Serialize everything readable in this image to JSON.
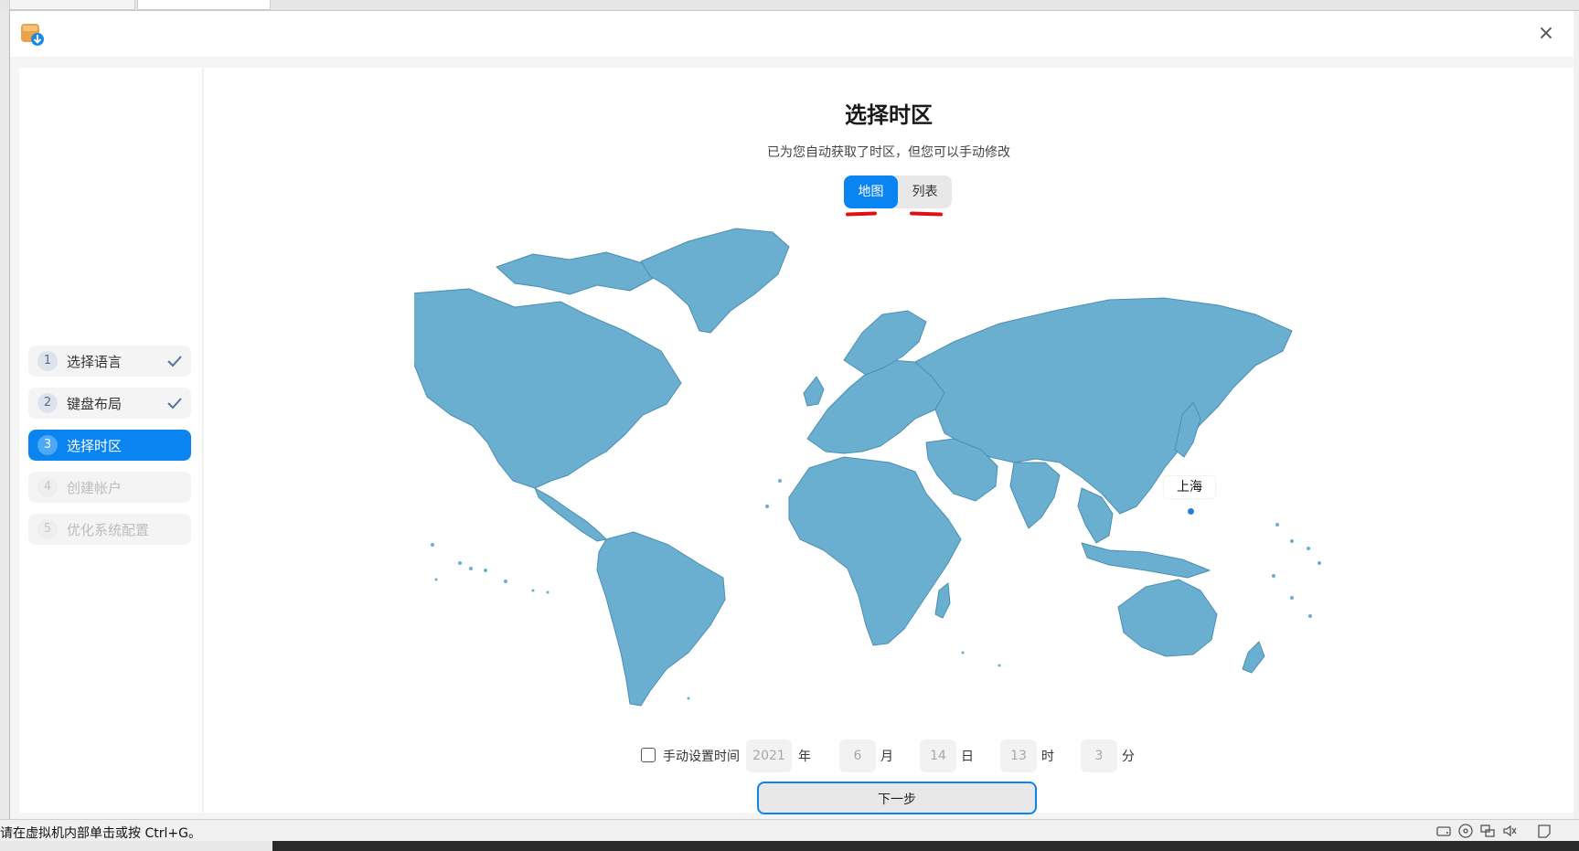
{
  "window": {
    "close_icon": "close-icon",
    "app_icon": "installer-app-icon"
  },
  "sidebar": {
    "steps": [
      {
        "num": "1",
        "label": "选择语言",
        "state": "done"
      },
      {
        "num": "2",
        "label": "键盘布局",
        "state": "done"
      },
      {
        "num": "3",
        "label": "选择时区",
        "state": "active"
      },
      {
        "num": "4",
        "label": "创建帐户",
        "state": "disabled"
      },
      {
        "num": "5",
        "label": "优化系统配置",
        "state": "disabled"
      }
    ]
  },
  "main": {
    "title": "选择时区",
    "subtitle": "已为您自动获取了时区，但您可以手动修改",
    "tabs": [
      {
        "label": "地图",
        "selected": true
      },
      {
        "label": "列表",
        "selected": false
      }
    ],
    "map": {
      "selected_city": "上海",
      "land_color": "#6aaed0",
      "border_color": "#4b8fb5"
    },
    "manual_time": {
      "label": "手动设置时间",
      "checked": false,
      "year": "2021",
      "year_unit": "年",
      "month": "6",
      "month_unit": "月",
      "day": "14",
      "day_unit": "日",
      "hour": "13",
      "hour_unit": "时",
      "minute": "3",
      "minute_unit": "分"
    },
    "next_label": "下一步"
  },
  "statusbar": {
    "text": "请在虚拟机内部单击或按 Ctrl+G。",
    "tray_icons": [
      "hdd-icon",
      "cd-icon",
      "network-icon",
      "sound-icon",
      "message-icon"
    ]
  },
  "colors": {
    "accent": "#0a84f0",
    "annotation": "#e01010"
  }
}
